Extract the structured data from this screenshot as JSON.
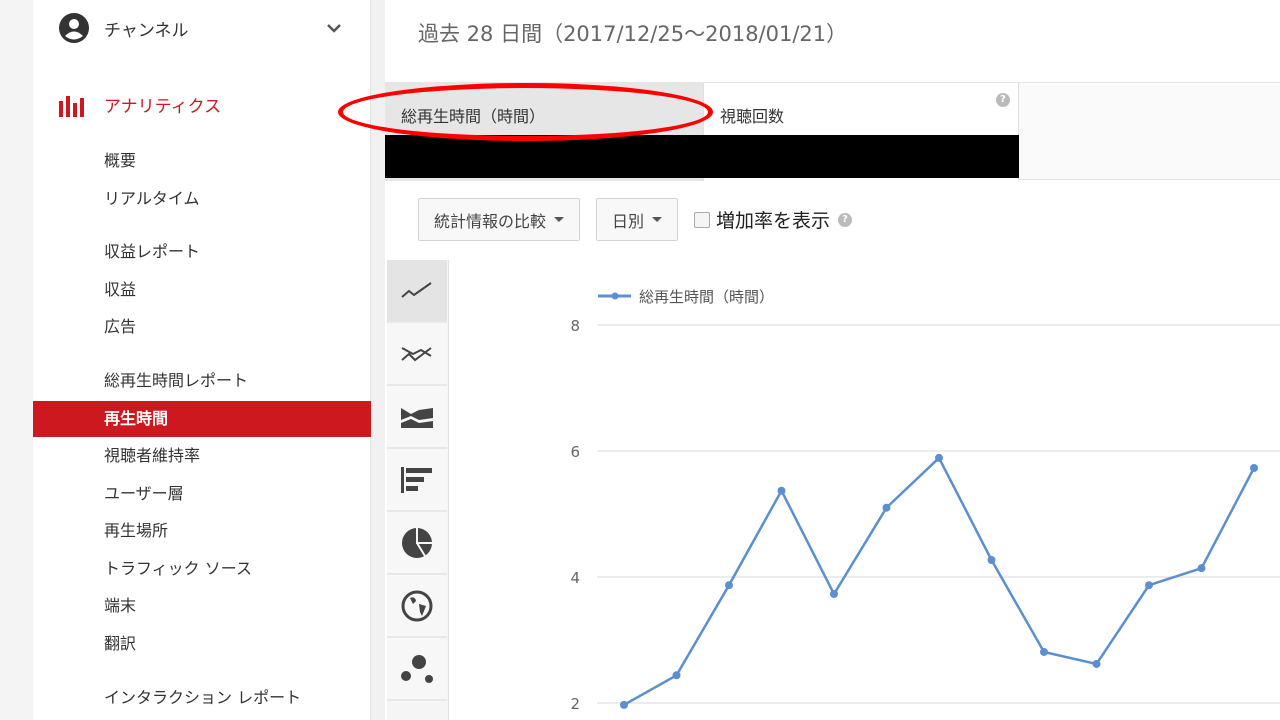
{
  "sidebar": {
    "channel": {
      "label": "チャンネル",
      "icon": "account-circle-icon"
    },
    "analytics": {
      "label": "アナリティクス",
      "icon": "bar-chart-icon",
      "color": "#cc181e"
    },
    "items": [
      "概要",
      "リアルタイム",
      "収益レポート",
      "収益",
      "広告",
      "総再生時間レポート",
      "再生時間",
      "視聴者維持率",
      "ユーザー層",
      "再生場所",
      "トラフィック ソース",
      "端末",
      "翻訳",
      "インタラクション レポート"
    ],
    "active": "再生時間"
  },
  "main": {
    "title": "過去 28 日間（2017/12/25～2018/01/21）",
    "tabs": [
      {
        "label": "総再生時間（時間）",
        "selected": true
      },
      {
        "label": "視聴回数",
        "selected": false
      }
    ],
    "compare_button": "統計情報の比較",
    "interval_button": "日別",
    "growth_checkbox": {
      "label": "増加率を表示",
      "checked": false
    },
    "chart_types": [
      "line-chart-icon",
      "multi-line-chart-icon",
      "stacked-area-icon",
      "bar-chart-icon",
      "pie-chart-icon",
      "globe-icon",
      "bubble-chart-icon"
    ]
  },
  "chart_data": {
    "type": "line",
    "series": [
      {
        "name": "総再生時間（時間）",
        "color": "#5b8fcf",
        "values": [
          1.97,
          2.44,
          3.87,
          5.37,
          3.73,
          5.1,
          5.89,
          4.27,
          2.81,
          2.62,
          3.87,
          4.14,
          5.73
        ]
      }
    ],
    "yticks": [
      "2",
      "4",
      "6",
      "8"
    ],
    "ylim": [
      2,
      8
    ],
    "grid": true,
    "legend": "top-left"
  },
  "annotation": {
    "color": "#ff0000",
    "shape": "oval"
  }
}
